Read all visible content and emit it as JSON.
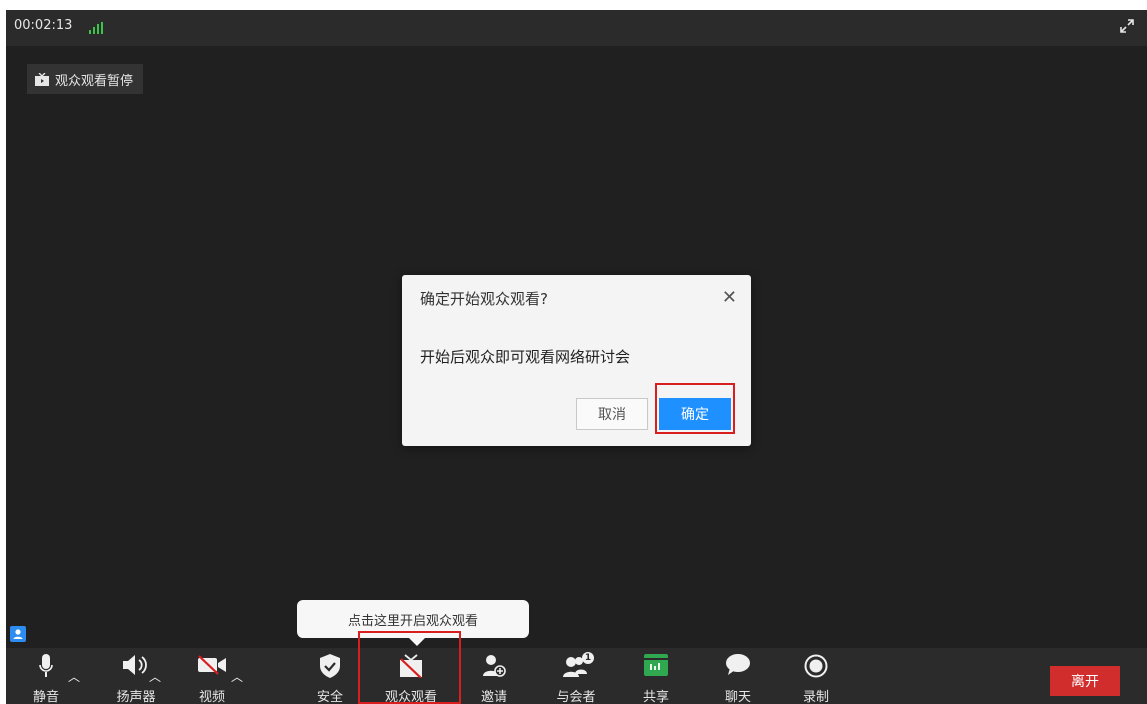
{
  "topbar": {
    "timer": "00:02:13",
    "fullscreen_icon": "expand-icon"
  },
  "status_badge": {
    "label": "观众观看暂停",
    "icon": "tv-icon"
  },
  "dialog": {
    "title": "确定开始观众观看?",
    "message": "开始后观众即可观看网络研讨会",
    "cancel_label": "取消",
    "confirm_label": "确定",
    "close_icon": "close-icon"
  },
  "tooltip": {
    "text": "点击这里开启观众观看"
  },
  "toolbar": {
    "items": [
      {
        "label": "静音",
        "icon": "microphone-icon"
      },
      {
        "label": "扬声器",
        "icon": "speaker-icon"
      },
      {
        "label": "视频",
        "icon": "video-off-icon"
      },
      {
        "label": "安全",
        "icon": "shield-icon"
      },
      {
        "label": "观众观看",
        "icon": "tv-off-icon"
      },
      {
        "label": "邀请",
        "icon": "add-user-icon"
      },
      {
        "label": "与会者",
        "icon": "participants-icon",
        "badge": "1"
      },
      {
        "label": "共享",
        "icon": "share-icon"
      },
      {
        "label": "聊天",
        "icon": "chat-icon"
      },
      {
        "label": "录制",
        "icon": "record-icon"
      }
    ],
    "leave_label": "离开"
  },
  "colors": {
    "accent": "#1e90ff",
    "leave": "#d12d2d",
    "highlight": "#d81e1e",
    "signal": "#3ec34a"
  }
}
